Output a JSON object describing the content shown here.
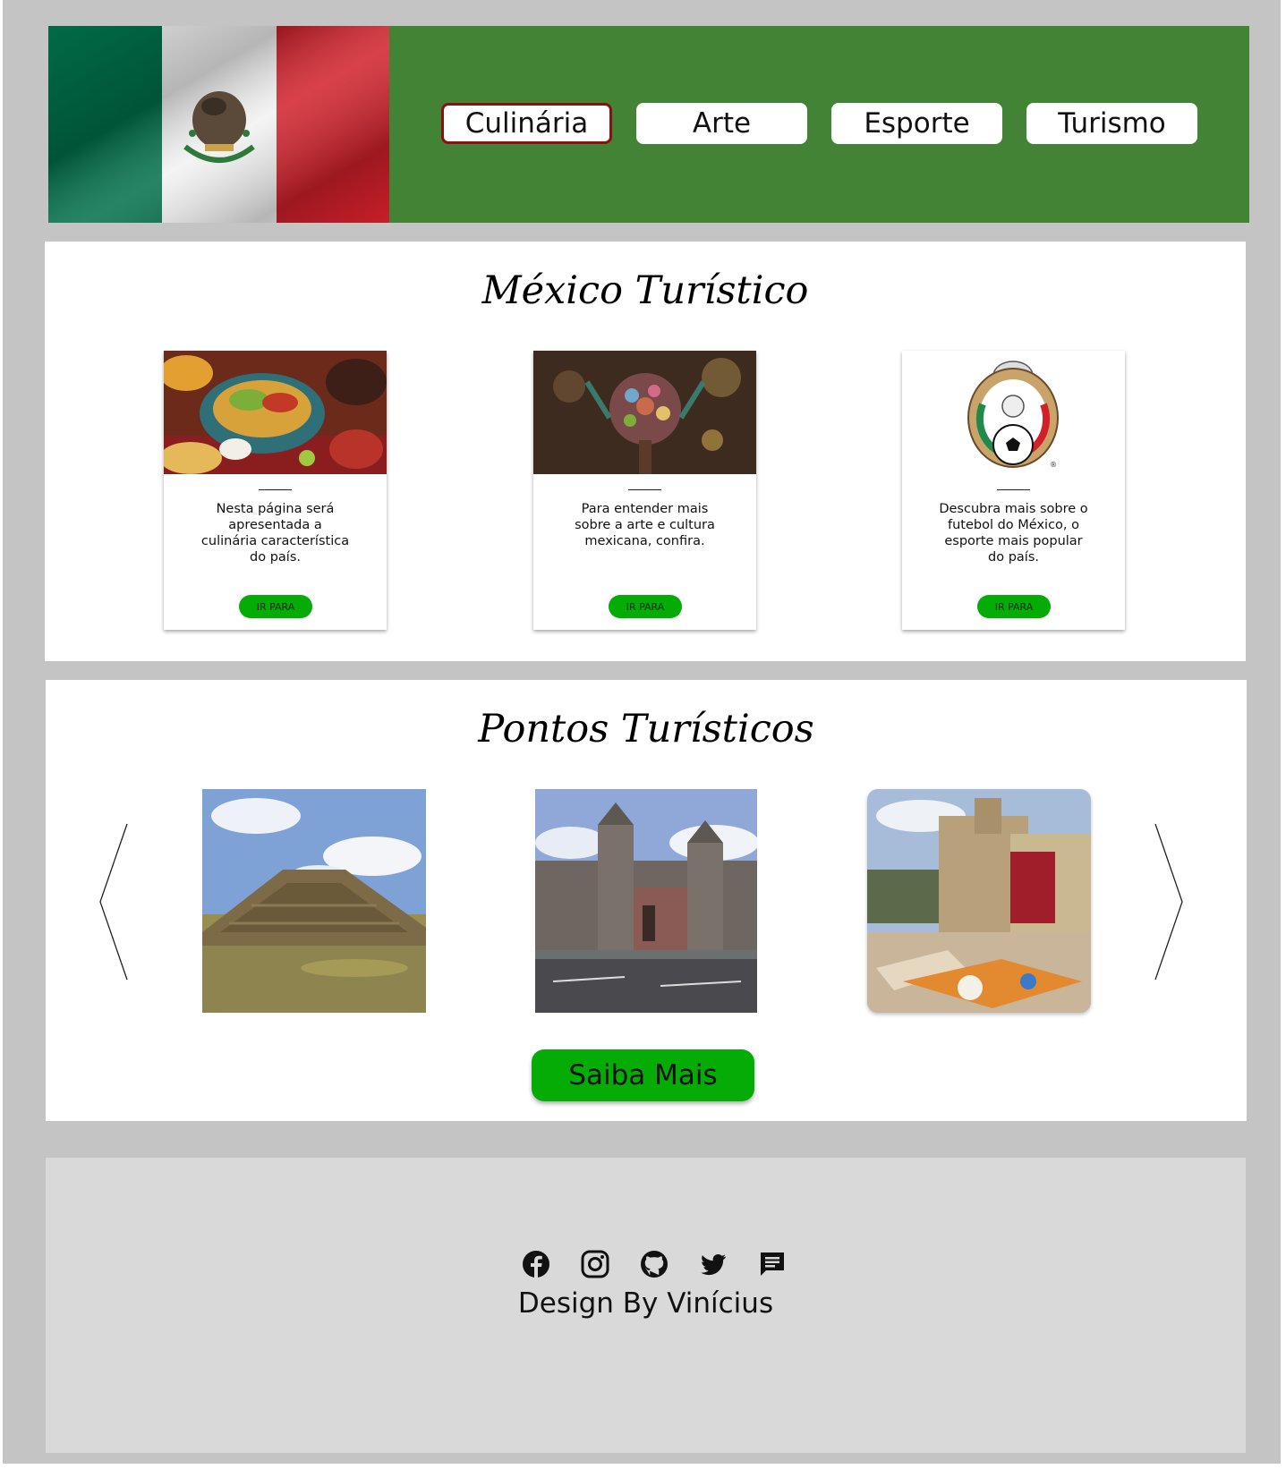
{
  "nav": {
    "items": [
      {
        "label": "Culinária",
        "active": true
      },
      {
        "label": "Arte",
        "active": false
      },
      {
        "label": "Esporte",
        "active": false
      },
      {
        "label": "Turismo",
        "active": false
      }
    ]
  },
  "flag": {
    "colors": {
      "green": "#006847",
      "white": "#ffffff",
      "red": "#ce1126"
    }
  },
  "intro": {
    "title": "México Turístico",
    "cards": [
      {
        "text": "Nesta página será apresentada a culinária característica do país.",
        "button": "IR PARA",
        "image": "mexican-food-photo"
      },
      {
        "text": "Para entender mais sobre a arte e cultura mexicana, confira.",
        "button": "IR PARA",
        "image": "mexican-art-photo"
      },
      {
        "text": "Descubra mais sobre o futebol do México, o esporte mais popular do país.",
        "button": "IR PARA",
        "image": "football-federation-crest"
      }
    ]
  },
  "tourism": {
    "title": "Pontos Turísticos",
    "photos": [
      "pyramid-photo",
      "cathedral-photo",
      "church-square-photo"
    ],
    "button": "Saiba Mais"
  },
  "footer": {
    "icons": [
      "facebook-icon",
      "instagram-icon",
      "github-icon",
      "twitter-icon",
      "message-icon"
    ],
    "credit": "Design By Vinícius"
  },
  "colors": {
    "header_green": "#428336",
    "button_green": "#05ac05",
    "page_gray": "#c4c4c4",
    "footer_gray": "#d9d9d9",
    "active_border": "#8b1010"
  }
}
